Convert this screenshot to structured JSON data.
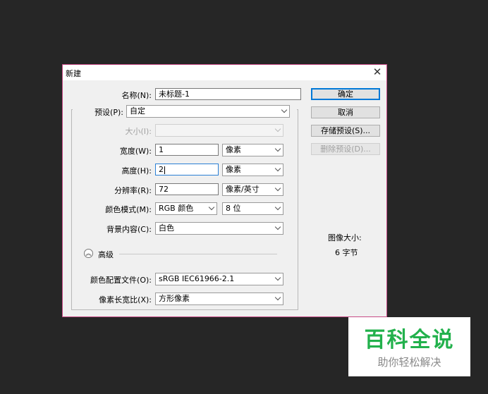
{
  "dialog": {
    "title": "新建",
    "close_glyph": "✕"
  },
  "form": {
    "name": {
      "label": "名称(N):",
      "value": "未标题-1"
    },
    "preset": {
      "label": "预设(P):",
      "value": "自定"
    },
    "size": {
      "label": "大小(I):",
      "value": ""
    },
    "width": {
      "label": "宽度(W):",
      "value": "1",
      "unit": "像素"
    },
    "height": {
      "label": "高度(H):",
      "value": "2",
      "unit": "像素"
    },
    "resolution": {
      "label": "分辨率(R):",
      "value": "72",
      "unit": "像素/英寸"
    },
    "color_mode": {
      "label": "颜色模式(M):",
      "mode": "RGB 颜色",
      "depth": "8 位"
    },
    "background": {
      "label": "背景内容(C):",
      "value": "白色"
    },
    "advanced": {
      "label": "高级",
      "icon": "chevrons-up-icon",
      "glyph": "︽"
    },
    "color_profile": {
      "label": "颜色配置文件(O):",
      "value": "sRGB IEC61966-2.1"
    },
    "pixel_aspect": {
      "label": "像素长宽比(X):",
      "value": "方形像素"
    }
  },
  "buttons": {
    "ok": "确定",
    "cancel": "取消",
    "save_preset": "存储预设(S)...",
    "delete_preset": "删除预设(D)..."
  },
  "info": {
    "image_size_label": "图像大小:",
    "image_size_value": "6 字节"
  },
  "watermark": {
    "title": "百科全说",
    "subtitle": "助你轻松解决",
    "color": "#22b14c"
  },
  "colors": {
    "dialog_border": "#c74b86",
    "focus_border": "#2a7fd4",
    "default_button_border": "#0078d7",
    "backdrop": "#262626"
  }
}
